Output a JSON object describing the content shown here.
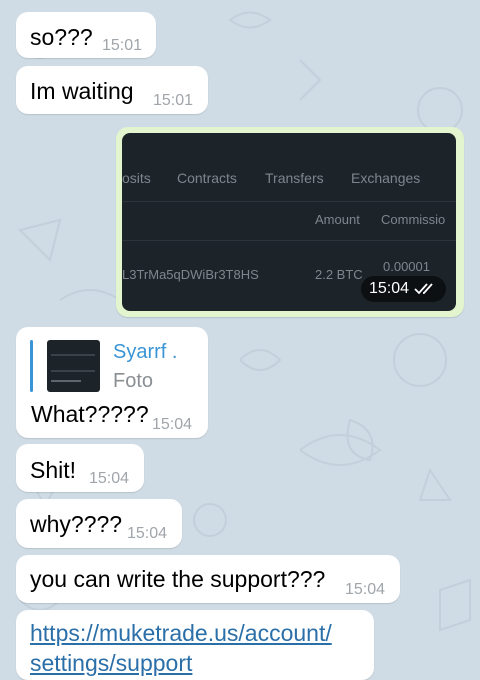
{
  "colors": {
    "incoming_bubble": "#ffffff",
    "outgoing_bubble": "#e3f5cf",
    "link": "#2b6fa8",
    "quote_accent": "#3a95d6",
    "wallpaper": "#cfdce5"
  },
  "messages": [
    {
      "text": "so???",
      "time": "15:01"
    },
    {
      "text": "Im waiting",
      "time": "15:01"
    },
    {
      "type": "photo",
      "time": "15:04",
      "status_icon": "double-check-icon",
      "screenshot_text": {
        "tabs": [
          "osits",
          "Contracts",
          "Transfers",
          "Exchanges"
        ],
        "headers": [
          "Amount",
          "Commissio"
        ],
        "row": {
          "address": "L3TrMa5qDWiBr3T8HS",
          "amount": "2.2 BTC",
          "commission": "0.00001"
        }
      }
    },
    {
      "reply_to": {
        "name": "Syarrf .",
        "subtitle": "Foto",
        "thumb_icon": "photo-thumbnail-icon"
      },
      "text": "What?????",
      "time": "15:04"
    },
    {
      "text": "Shit!",
      "time": "15:04"
    },
    {
      "text": "why????",
      "time": "15:04"
    },
    {
      "text": "you can write the support???",
      "time": "15:04"
    },
    {
      "link_line1": "https://muketrade.us/account/",
      "link_line2": "settings/support"
    }
  ]
}
